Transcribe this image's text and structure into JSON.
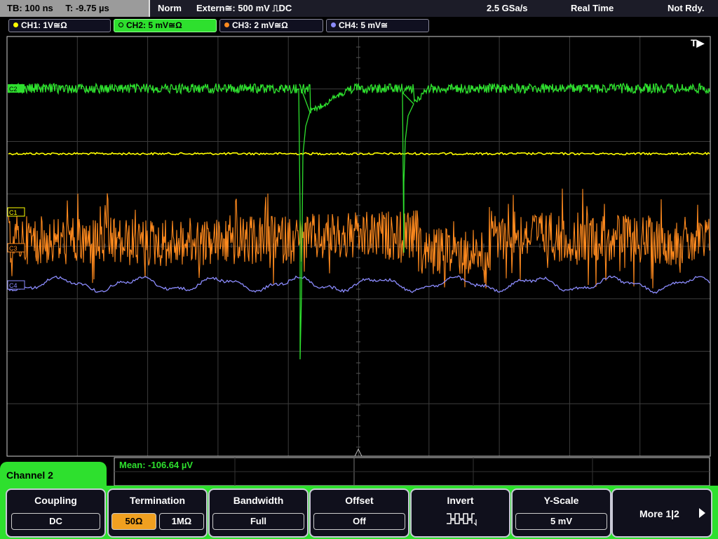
{
  "topbar": {
    "tb": "TB: 100 ns",
    "t": "T: -9.75 µs",
    "mode": "Norm",
    "trigger": "Extern≅: 500 mV ⎍DC",
    "rate": "2.5 GSa/s",
    "acq": "Real Time",
    "status": "Not Rdy."
  },
  "channels": [
    {
      "label": "CH1: 1V≅Ω",
      "color": "#ffff00"
    },
    {
      "label": "CH2: 5 mV≅Ω",
      "color": "#2ee02e"
    },
    {
      "label": "CH3: 2 mV≅Ω",
      "color": "#ff8a1e"
    },
    {
      "label": "CH4: 5 mV≅",
      "color": "#8c8cff"
    }
  ],
  "markers": {
    "trigger": "T▶",
    "c1": "C1",
    "c2": "C2",
    "c3": "C3",
    "c4": "C4"
  },
  "measurement": {
    "mean": "Mean: -106.64 µV"
  },
  "menu": {
    "title": "Channel 2",
    "coupling": {
      "label": "Coupling",
      "value": "DC"
    },
    "termination": {
      "label": "Termination",
      "options": [
        "50Ω",
        "1MΩ"
      ],
      "selected": "50Ω"
    },
    "bandwidth": {
      "label": "Bandwidth",
      "value": "Full"
    },
    "offset": {
      "label": "Offset",
      "value": "Off"
    },
    "invert": {
      "label": "Invert",
      "icon": "invert-waveform-icon"
    },
    "yscale": {
      "label": "Y-Scale",
      "value": "5 mV"
    },
    "more": "More 1|2"
  },
  "colors": {
    "accent": "#2ee02e",
    "grid": "#3c3c3c",
    "selected": "#f0a020"
  }
}
